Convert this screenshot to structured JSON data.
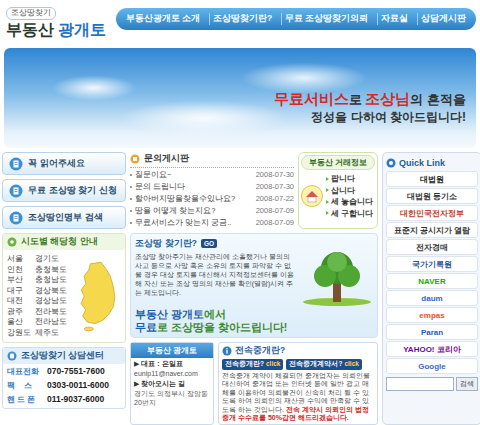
{
  "logo": {
    "tagline": "조상땅찾기",
    "name": "부동산",
    "brand": "광개토"
  },
  "nav": [
    {
      "label": "부동산광개토 소개",
      "selected": false
    },
    {
      "label": "조상땅찾기란?",
      "selected": false
    },
    {
      "label": "무료 조상땅찾기의뢰",
      "selected": false
    },
    {
      "label": "자료실",
      "selected": false
    },
    {
      "label": "상담게시판",
      "selected": false
    }
  ],
  "banner": {
    "lines": [
      [
        {
          "text": "무료서비스",
          "em": true
        },
        {
          "text": "로 ",
          "em": false
        },
        {
          "text": "조상님",
          "em": true
        },
        {
          "text": "의 흔적을",
          "em": false
        }
      ],
      [
        {
          "text": "정성을 다하여 찾아드립니다!",
          "em": false
        }
      ]
    ]
  },
  "side_buttons": [
    "꼭 읽어주세요",
    "무료 조상땅 찾기 신청",
    "조상땅인명부 검색"
  ],
  "regions": {
    "title": "시도별 해당청 안내",
    "items": [
      "서울",
      "인천",
      "부산",
      "대구",
      "대전",
      "광주",
      "울산",
      "강원도",
      "경기도",
      "충청북도",
      "충청남도",
      "경상북도",
      "경상남도",
      "전라북도",
      "전라남도",
      "제주도"
    ]
  },
  "consult": {
    "title": "조상땅찾기 상담센터",
    "rows": [
      {
        "label": "대표전화",
        "value": "070-7551-7600"
      },
      {
        "label": "팩    스",
        "value": "0303-0011-6000"
      },
      {
        "label": "핸 드 폰",
        "value": "011-9037-6000"
      }
    ]
  },
  "board": {
    "title": "문의게시판",
    "posts": [
      {
        "title": "질문이요~",
        "date": "2008-07-30"
      },
      {
        "title": "문의 드립니다",
        "date": "2008-07-30"
      },
      {
        "title": "할아버지땅을찾을수있나요?",
        "date": "2008-07-22"
      },
      {
        "title": "땅을 어떻게 찾는지요?",
        "date": "2008-07-09"
      },
      {
        "title": "무료서비스가 맞는지 궁금..",
        "date": "2008-07-09"
      }
    ]
  },
  "trade": {
    "title": "부동산 거래정보",
    "items": [
      "팝니다",
      "삽니다",
      "세 놓습니다",
      "세 구합니다"
    ]
  },
  "about": {
    "title": "조상땅 찾기란?",
    "go": "GO",
    "text": "조상땅 찾아주기는 재산관리에 소홀했거나 불의의 사고 등으로 사망 혹은 소유의 토지를 파악할 수 없을 경우 대상 토지를 대신해서 지적정보센터를 이용해 자신 또는 조상 명의의 재산을 확인(열람)시켜 주는 제도입니다.",
    "slogan": [
      [
        {
          "text": "부동산 광개토",
          "em": true
        },
        {
          "text": "에서",
          "em": false
        }
      ],
      [
        {
          "text": "무료",
          "em": true
        },
        {
          "text": "로 조상땅을 찾아드립니다!",
          "em": false
        }
      ]
    ]
  },
  "company": {
    "title": "부동산 광개토",
    "lines": [
      {
        "text": "▶ 대표 : 은일표",
        "kind": "heading"
      },
      {
        "text": "eunip11@naver.com",
        "kind": "detail"
      },
      {
        "text": "▶ 찾아오시는 길",
        "kind": "heading"
      },
      {
        "text": "경기도 의정부시 장암동 20번지",
        "kind": "detail"
      }
    ]
  },
  "exclusive": {
    "title": "전속중개란?",
    "tabs": [
      {
        "label": "전속중개란?",
        "action": "click"
      },
      {
        "label": "전속중개계약서?",
        "action": "click"
      }
    ],
    "text": "전속중개 계약이 체결되면 중개업자는 의뢰인을 대신하여 중개업 또는 인터넷 등에 일반 광고 매체를 이용하여 의뢰물건이 신속히 처리 될 수 있도록 하여 의뢰인의 재산권 수익에 만족할 수 있도록 하는 것입니다. ",
    "highlight": "전속 계약시 의뢰인의 법정 중개 수수료를 50%감면 해드리겠습니다."
  },
  "quick_links": {
    "title": "Quick Link",
    "items": [
      {
        "label": "대법원",
        "color": "#222222"
      },
      {
        "label": "대법원 등기소",
        "color": "#333333"
      },
      {
        "label": "대한민국전자정부",
        "color": "#c0392b"
      },
      {
        "label": "표준지 공시지가 열람",
        "color": "#333333"
      },
      {
        "label": "전자경매",
        "color": "#333333"
      },
      {
        "label": "국가기록원",
        "color": "#1f4fa0"
      },
      {
        "label": "NAVER",
        "color": "#1fa800"
      },
      {
        "label": "daum",
        "color": "#3366cc"
      },
      {
        "label": "empas",
        "color": "#e8531f"
      },
      {
        "label": "Paran",
        "color": "#2a5db0"
      },
      {
        "label": "YAHOO! 코리아",
        "color": "#7b0099"
      },
      {
        "label": "Google",
        "color": "#3a66d1"
      }
    ],
    "search_button": "검색"
  }
}
